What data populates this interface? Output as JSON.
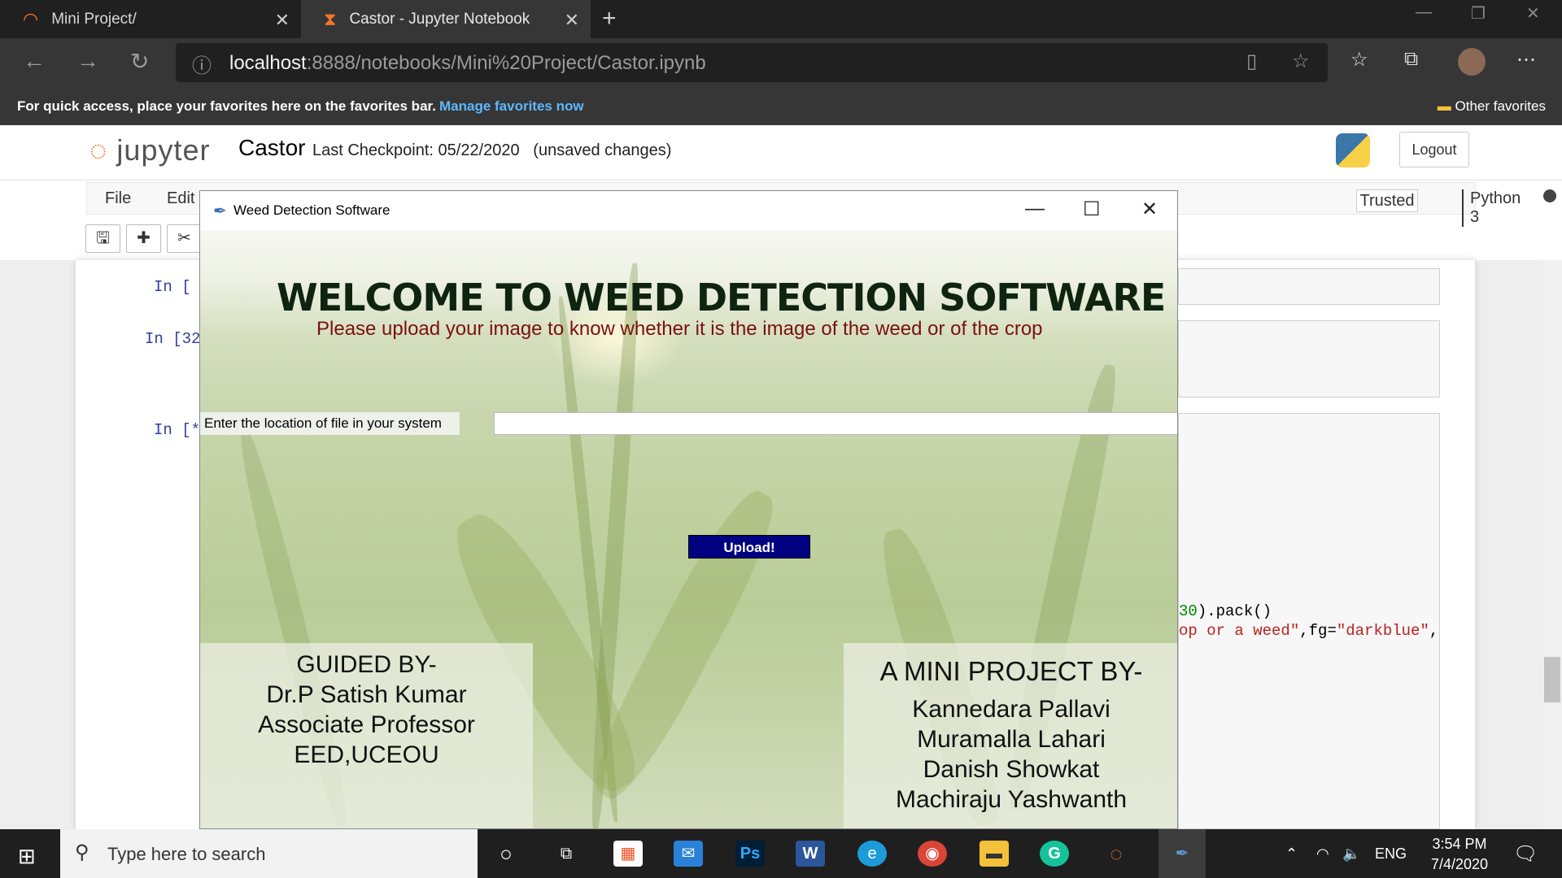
{
  "browser": {
    "tabs": [
      {
        "title": "Mini Project/",
        "close": "✕"
      },
      {
        "title": "Castor - Jupyter Notebook",
        "close": "✕"
      }
    ],
    "new_tab": "+",
    "url_host": "localhost",
    "url_rest": ":8888/notebooks/Mini%20Project/Castor.ipynb",
    "fav_message": "For quick access, place your favorites here on the favorites bar.",
    "fav_link": "Manage favorites now",
    "other_favorites": "Other favorites"
  },
  "jupyter": {
    "logo": "jupyter",
    "notebook_name": "Castor",
    "checkpoint": "Last Checkpoint: 05/22/2020   (unsaved changes)",
    "logout": "Logout",
    "menu": [
      "File",
      "Edit"
    ],
    "trusted": "Trusted",
    "kernel": "Python 3",
    "prompts": [
      "In [",
      "In [32",
      "In [*"
    ],
    "code_line1_tail": ").pack()",
    "code_line1_num": "30",
    "code_line2_str": "op or a weed\"",
    "code_line2_mid": ",fg=",
    "code_line2_str2": "\"darkblue\"",
    "code_line2_end": ","
  },
  "app": {
    "window_title": "Weed Detection Software",
    "heading": "WELCOME TO WEED DETECTION SOFTWARE",
    "subheading": "Please upload your image to know whether it is the image of the weed or of the crop",
    "file_label": "Enter the location of file in your system",
    "file_value": "",
    "upload_button": "Upload!",
    "guided_by": [
      "GUIDED BY-",
      "Dr.P Satish Kumar",
      "Associate Professor",
      "EED,UCEOU"
    ],
    "project_by_title": "A MINI PROJECT BY-",
    "project_by": [
      "Kannedara Pallavi",
      "Muramalla Lahari",
      "Danish Showkat",
      "Machiraju Yashwanth"
    ]
  },
  "taskbar": {
    "search_placeholder": "Type here to search",
    "lang": "ENG",
    "time": "3:54 PM",
    "date": "7/4/2020"
  }
}
